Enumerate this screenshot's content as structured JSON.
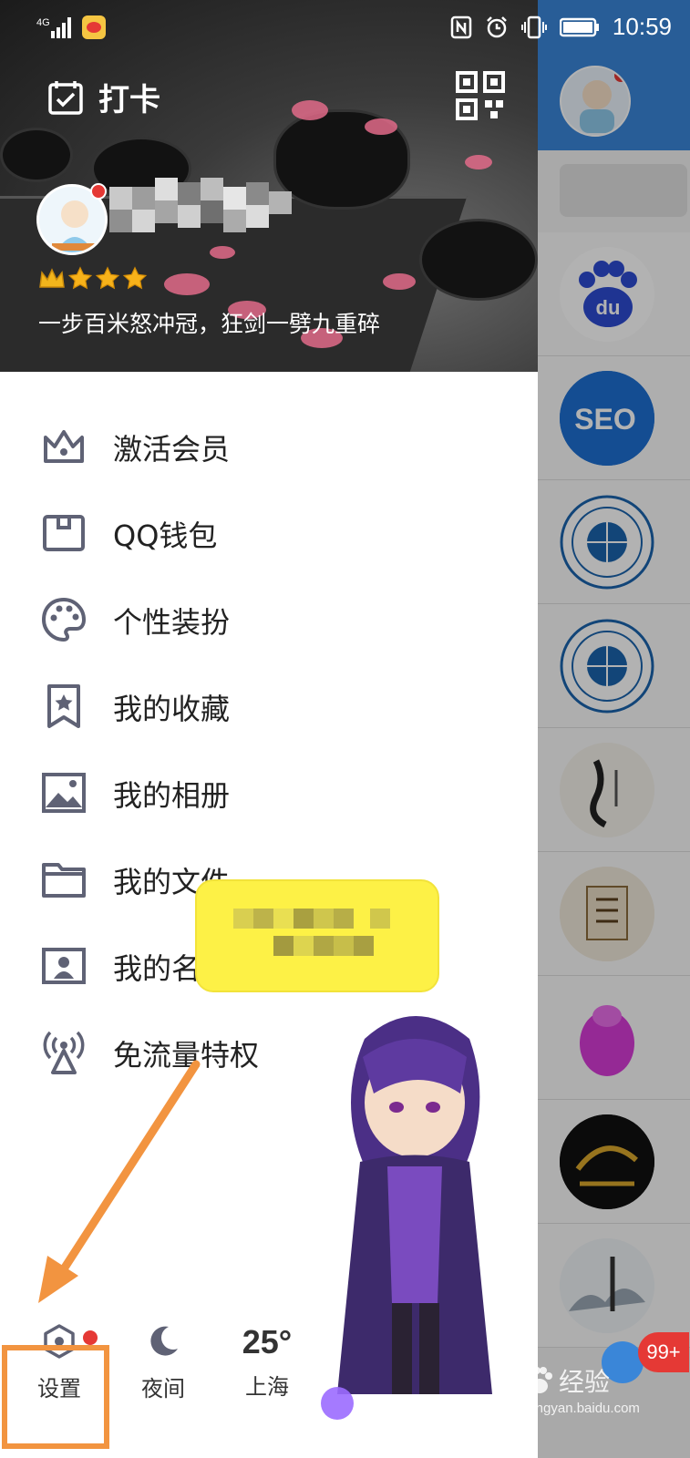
{
  "status_bar": {
    "network": "4G",
    "time": "10:59",
    "icons": [
      "signal-icon",
      "weibo-icon",
      "nfc-icon",
      "alarm-icon",
      "vibrate-icon",
      "battery-icon"
    ]
  },
  "header": {
    "checkin_label": "打卡",
    "qr_icon": "qr-code-icon",
    "level_icons": [
      "crown-icon",
      "star-icon",
      "star-icon",
      "star-icon"
    ],
    "signature": "一步百米怒冲冠，狂剑一劈九重碎"
  },
  "menu": {
    "items": [
      {
        "label": "激活会员",
        "icon": "crown-outline-icon"
      },
      {
        "label": "QQ钱包",
        "icon": "wallet-icon"
      },
      {
        "label": "个性装扮",
        "icon": "palette-icon"
      },
      {
        "label": "我的收藏",
        "icon": "bookmark-star-icon"
      },
      {
        "label": "我的相册",
        "icon": "picture-icon"
      },
      {
        "label": "我的文件",
        "icon": "folder-icon"
      },
      {
        "label": "我的名片",
        "icon": "id-card-icon"
      },
      {
        "label": "免流量特权",
        "icon": "signal-tower-icon"
      }
    ]
  },
  "bottom_bar": {
    "settings_label": "设置",
    "night_label": "夜间",
    "temperature": "25°",
    "city": "上海"
  },
  "right_panel": {
    "unread_badge": "99+"
  },
  "watermark": {
    "text": "经验",
    "url": "jingyan.baidu.com"
  },
  "colors": {
    "accent_blue": "#3a86d8",
    "notification_red": "#e53935",
    "highlight_orange": "#f29440",
    "bubble_yellow": "#fdf146",
    "icon_gray": "#5f6275"
  }
}
